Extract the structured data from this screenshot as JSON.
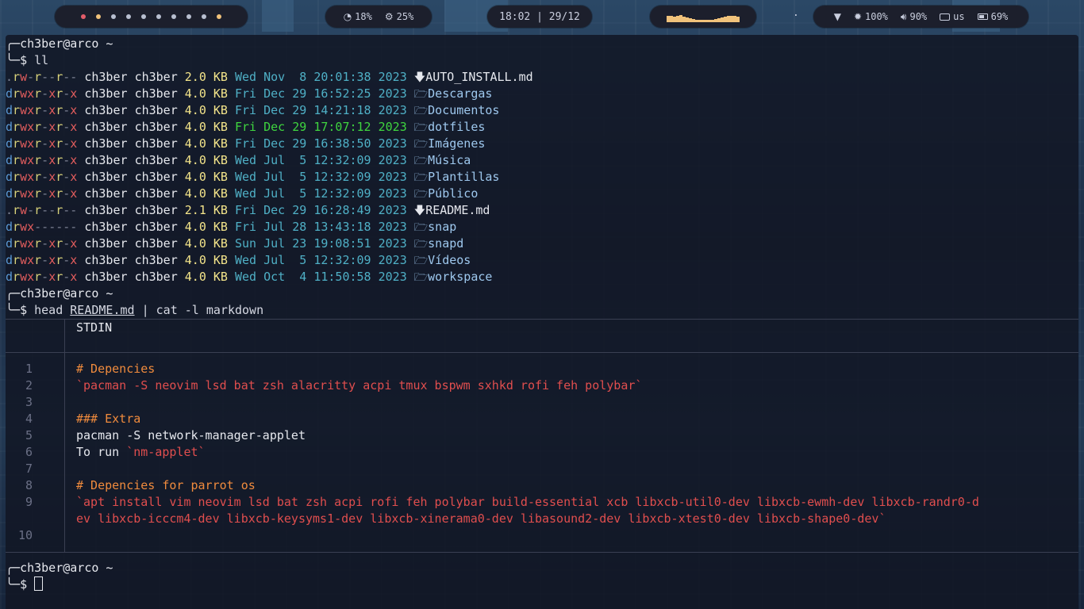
{
  "topbar": {
    "workspace_colors": [
      "#e35d6a",
      "#f0c27b",
      "#b8bfd0",
      "#b8bfd0",
      "#b8bfd0",
      "#b8bfd0",
      "#b8bfd0",
      "#b8bfd0",
      "#b8bfd0",
      "#f0c27b"
    ],
    "cpu": "18%",
    "mem": "25%",
    "clock": "18:02 | 29/12",
    "tray_dot": ".",
    "wifi": "100%",
    "volume": "90%",
    "kbd_layout": "us",
    "battery": "69%",
    "battery_level": 0.69,
    "accent": "#f0c27b"
  },
  "prompt": {
    "user": "ch3ber@arco ~",
    "symbol": "$"
  },
  "cmd1": "ll",
  "listing": [
    {
      "perm": ".rw-r--r--",
      "owner": "ch3ber",
      "group": "ch3ber",
      "size": "2.0 KB",
      "date": "Wed Nov  8 20:01:38 2023",
      "icon": "file-down-icon",
      "name": "AUTO_INSTALL.md",
      "type": "file"
    },
    {
      "perm": "drwxr-xr-x",
      "owner": "ch3ber",
      "group": "ch3ber",
      "size": "4.0 KB",
      "date": "Fri Dec 29 16:52:25 2023",
      "icon": "folder-icon",
      "name": "Descargas",
      "type": "dir"
    },
    {
      "perm": "drwxr-xr-x",
      "owner": "ch3ber",
      "group": "ch3ber",
      "size": "4.0 KB",
      "date": "Fri Dec 29 14:21:18 2023",
      "icon": "folder-icon",
      "name": "Documentos",
      "type": "dir"
    },
    {
      "perm": "drwxr-xr-x",
      "owner": "ch3ber",
      "group": "ch3ber",
      "size": "4.0 KB",
      "date": "Fri Dec 29 17:07:12 2023",
      "icon": "folder-icon",
      "name": "dotfiles",
      "type": "dir",
      "recent": true
    },
    {
      "perm": "drwxr-xr-x",
      "owner": "ch3ber",
      "group": "ch3ber",
      "size": "4.0 KB",
      "date": "Fri Dec 29 16:38:50 2023",
      "icon": "folder-icon",
      "name": "Imágenes",
      "type": "dir"
    },
    {
      "perm": "drwxr-xr-x",
      "owner": "ch3ber",
      "group": "ch3ber",
      "size": "4.0 KB",
      "date": "Wed Jul  5 12:32:09 2023",
      "icon": "folder-icon",
      "name": "Música",
      "type": "dir"
    },
    {
      "perm": "drwxr-xr-x",
      "owner": "ch3ber",
      "group": "ch3ber",
      "size": "4.0 KB",
      "date": "Wed Jul  5 12:32:09 2023",
      "icon": "folder-icon",
      "name": "Plantillas",
      "type": "dir"
    },
    {
      "perm": "drwxr-xr-x",
      "owner": "ch3ber",
      "group": "ch3ber",
      "size": "4.0 KB",
      "date": "Wed Jul  5 12:32:09 2023",
      "icon": "folder-icon",
      "name": "Público",
      "type": "dir"
    },
    {
      "perm": ".rw-r--r--",
      "owner": "ch3ber",
      "group": "ch3ber",
      "size": "2.1 KB",
      "date": "Fri Dec 29 16:28:49 2023",
      "icon": "file-down-icon",
      "name": "README.md",
      "type": "file"
    },
    {
      "perm": "drwx------",
      "owner": "ch3ber",
      "group": "ch3ber",
      "size": "4.0 KB",
      "date": "Fri Jul 28 13:43:18 2023",
      "icon": "folder-icon",
      "name": "snap",
      "type": "dir"
    },
    {
      "perm": "drwxr-xr-x",
      "owner": "ch3ber",
      "group": "ch3ber",
      "size": "4.0 KB",
      "date": "Sun Jul 23 19:08:51 2023",
      "icon": "folder-icon",
      "name": "snapd",
      "type": "dir"
    },
    {
      "perm": "drwxr-xr-x",
      "owner": "ch3ber",
      "group": "ch3ber",
      "size": "4.0 KB",
      "date": "Wed Jul  5 12:32:09 2023",
      "icon": "folder-icon",
      "name": "Vídeos",
      "type": "dir"
    },
    {
      "perm": "drwxr-xr-x",
      "owner": "ch3ber",
      "group": "ch3ber",
      "size": "4.0 KB",
      "date": "Wed Oct  4 11:50:58 2023",
      "icon": "folder-icon",
      "name": "workspace",
      "type": "dir"
    }
  ],
  "cmd2": {
    "prefix": "head ",
    "file": "README.md",
    "rest": " | cat -l markdown"
  },
  "bat": {
    "header": "STDIN",
    "lines": [
      {
        "n": "1",
        "parts": [
          {
            "t": "# Depencies",
            "c": "c-h"
          }
        ]
      },
      {
        "n": "2",
        "parts": [
          {
            "t": "`pacman -S neovim lsd bat zsh alacritty acpi tmux bspwm sxhkd rofi feh polybar`",
            "c": "c-red"
          }
        ]
      },
      {
        "n": "3",
        "parts": []
      },
      {
        "n": "4",
        "parts": [
          {
            "t": "### Extra",
            "c": "c-h"
          }
        ]
      },
      {
        "n": "5",
        "parts": [
          {
            "t": "pacman -S network-manager-applet",
            "c": "c-txt"
          }
        ]
      },
      {
        "n": "6",
        "parts": [
          {
            "t": "To run ",
            "c": "c-txt"
          },
          {
            "t": "`nm-applet`",
            "c": "c-red"
          }
        ]
      },
      {
        "n": "7",
        "parts": []
      },
      {
        "n": "8",
        "parts": [
          {
            "t": "# Depencies for parrot os",
            "c": "c-h"
          }
        ]
      },
      {
        "n": "9",
        "parts": [
          {
            "t": "`apt install vim neovim lsd bat zsh acpi rofi feh polybar build-essential xcb libxcb-util0-dev libxcb-ewmh-dev libxcb-randr0-d",
            "c": "c-red"
          }
        ]
      },
      {
        "n": "",
        "parts": [
          {
            "t": "ev libxcb-icccm4-dev libxcb-keysyms1-dev libxcb-xinerama0-dev libasound2-dev libxcb-xtest0-dev libxcb-shape0-dev`",
            "c": "c-red"
          }
        ]
      },
      {
        "n": "10",
        "parts": []
      }
    ]
  }
}
